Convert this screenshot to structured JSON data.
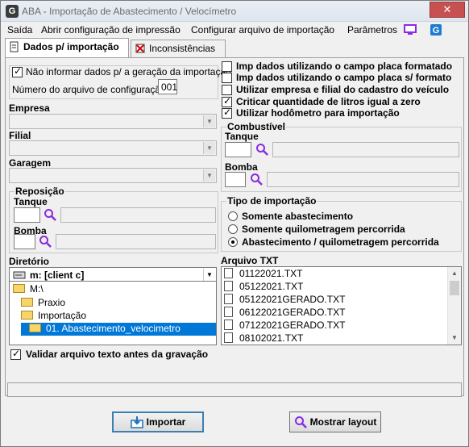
{
  "window": {
    "title": "ABA - Importação de Abastecimento / Velocímetro",
    "close_glyph": "✕",
    "app_icon_letter": "G"
  },
  "menu": {
    "items": [
      "Saída",
      "Abrir configuração de impressão",
      "Configurar arquivo de importação",
      "Parâmetros"
    ]
  },
  "tabs": [
    {
      "label": "Dados p/ importação"
    },
    {
      "label": "Inconsistências"
    }
  ],
  "left": {
    "no_inform_label": "Não informar dados p/ a geração da importação",
    "no_inform_checked": true,
    "config_number_label": "Número do arquivo de configuração",
    "config_number_value": "001",
    "empresa_label": "Empresa",
    "filial_label": "Filial",
    "garagem_label": "Garagem",
    "reposicao": {
      "legend": "Reposição",
      "tanque_label": "Tanque",
      "bomba_label": "Bomba"
    },
    "diretorio_label": "Diretório",
    "drive_value": "m: [client c]",
    "folders": [
      "M:\\",
      "Praxio",
      "Importação",
      "01. Abastecimento_velocimetro"
    ],
    "validar_label": "Validar arquivo texto antes da gravação",
    "validar_checked": true
  },
  "right": {
    "options": [
      {
        "label": "Imp dados utilizando o campo placa formatado",
        "checked": false
      },
      {
        "label": "Imp dados utilizando o campo placa s/ formato",
        "checked": false
      },
      {
        "label": "Utilizar empresa e filial do cadastro do veículo",
        "checked": false
      },
      {
        "label": "Criticar quantidade de litros igual a zero",
        "checked": true
      },
      {
        "label": "Utilizar hodômetro para importação",
        "checked": true
      }
    ],
    "combustivel": {
      "legend": "Combustível",
      "tanque_label": "Tanque",
      "bomba_label": "Bomba"
    },
    "tipo": {
      "legend": "Tipo de importação",
      "options": [
        {
          "label": "Somente abastecimento",
          "checked": false
        },
        {
          "label": "Somente quilometragem percorrida",
          "checked": false
        },
        {
          "label": "Abastecimento / quilometragem percorrida",
          "checked": true
        }
      ]
    },
    "arquivo_label": "Arquivo TXT",
    "files": [
      "01122021.TXT",
      "05122021.TXT",
      "05122021GERADO.TXT",
      "06122021GERADO.TXT",
      "07122021GERADO.TXT",
      "08102021.TXT"
    ]
  },
  "buttons": {
    "importar": "Importar",
    "mostrar": "Mostrar layout"
  }
}
